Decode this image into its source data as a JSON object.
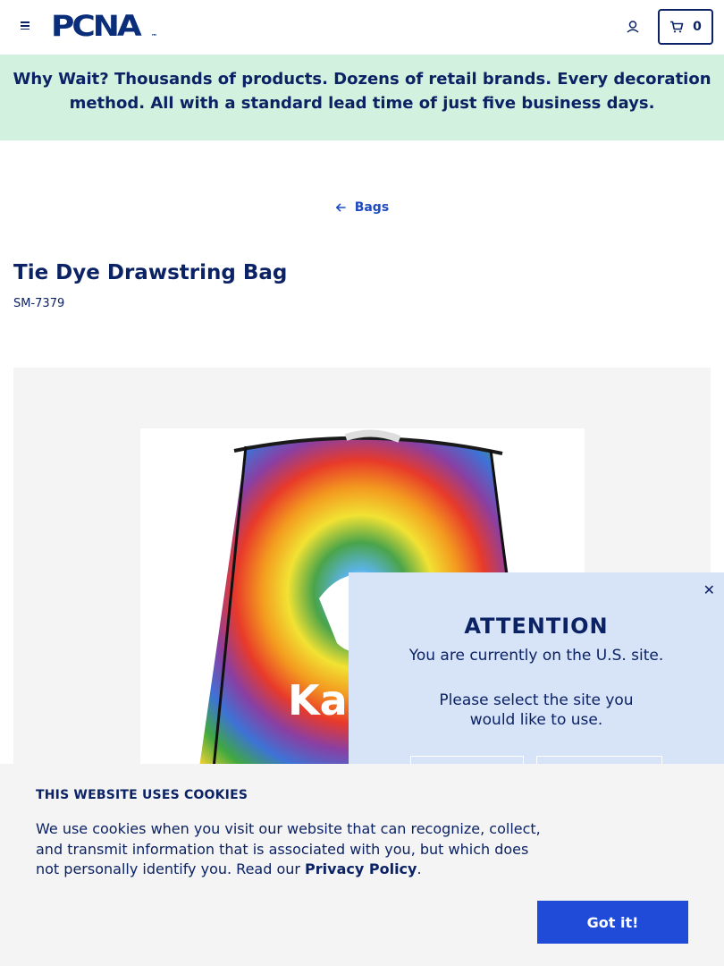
{
  "header": {
    "logo_text": "PCNA",
    "logo_tm": "™",
    "cart_count": "0",
    "icons": {
      "menu": "hamburger-icon",
      "account": "user-icon",
      "cart": "cart-icon"
    }
  },
  "promo": {
    "lead": "Why Wait?",
    "text": " Thousands of products. Dozens of retail brands. Every decoration method. All with a standard lead time of just five business days."
  },
  "breadcrumb": {
    "back_label": "Bags",
    "arrow_icon": "arrow-left-icon"
  },
  "product": {
    "title": "Tie Dye Drawstring Bag",
    "sku": "SM-7379"
  },
  "region_popup": {
    "heading": "ATTENTION",
    "current_site": "You are currently on the U.S. site.",
    "select_prompt": "Please select the site you would like to use.",
    "close_icon": "close-icon"
  },
  "cookie_banner": {
    "heading": "THIS WEBSITE USES COOKIES",
    "body": "We use cookies when you visit our website that can recognize, collect, and transmit information that is associated with you, but which does not personally identify you. Read our ",
    "link_label": "Privacy Policy",
    "period": ".",
    "accept_label": "Got it!"
  },
  "colors": {
    "navy": "#0b2265",
    "promo_bg": "#d3f1df",
    "accent_blue": "#1f4bd8",
    "popup_bg": "#d7e3f6"
  }
}
